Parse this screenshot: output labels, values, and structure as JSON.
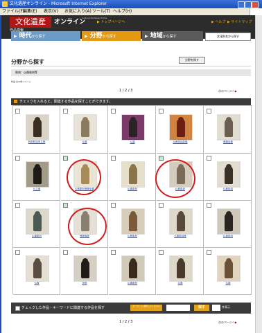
{
  "window": {
    "title": "文化遺産オンライン - Microsoft Internet Explorer"
  },
  "menu": [
    "ファイル(F)",
    "編集(E)",
    "表示(V)",
    "お気に入り(A)",
    "ツール(T)",
    "ヘルプ(H)"
  ],
  "header": {
    "logo_kanji": "文化遺産",
    "logo_online": "オンライン",
    "logo_sub": "Cultural Heritage Online",
    "toppage": "▶ トップページへ",
    "help": "▶ ヘルプ",
    "sitemap": "▶ サイトマップ",
    "search_label": "作品検索"
  },
  "tabs": [
    {
      "label": "時代",
      "small": "から探す"
    },
    {
      "label": "分野",
      "small": "から探す"
    },
    {
      "label": "地域",
      "small": "から探す"
    }
  ],
  "tab_button": "文化財名から探す",
  "page": {
    "title": "分野から探す",
    "change_button": "分野を探す",
    "condition": "彫刻：仏像彫刻等",
    "works_count": "作品 全99件 1ページ",
    "pager": "1 / 2 / 3",
    "next": "次のページへ",
    "next_mark": "▶",
    "instruction": "チェックを入れると、関連する作品を探すことができます。"
  },
  "grid": [
    {
      "caption": "阿弥陀如来立像",
      "checked": false,
      "figure": "#3a2e22",
      "bg": "#d9d4c7"
    },
    {
      "caption": "仏像",
      "checked": false,
      "figure": "#8a7a5e",
      "bg": "#e8e3d6"
    },
    {
      "caption": "仏頭",
      "checked": false,
      "figure": "#2a2228",
      "bg": "#7a3a6a"
    },
    {
      "caption": "仏教説話彫像",
      "checked": false,
      "figure": "#6a1e14",
      "bg": "#d08440"
    },
    {
      "caption": "菩薩坐像",
      "checked": false,
      "figure": "#6a5e50",
      "bg": "#e2ddd1"
    },
    {
      "caption": "仏立像",
      "checked": false,
      "figure": "#1e1a16",
      "bg": "#a49a88"
    },
    {
      "caption": "仏教彫刻菩薩坐像",
      "checked": true,
      "figure": "#a88a56",
      "bg": "#ece4d2"
    },
    {
      "caption": "仏像彫刻",
      "checked": false,
      "figure": "#8a7448",
      "bg": "#e6dfcc"
    },
    {
      "caption": "仏教彫刻",
      "checked": true,
      "figure": "#7a6a58",
      "bg": "#d4ccbc"
    },
    {
      "caption": "仏教彫刻",
      "checked": false,
      "figure": "#3a3026",
      "bg": "#e2ddd0"
    },
    {
      "caption": "仏像彫刻",
      "checked": false,
      "figure": "#4a5a52",
      "bg": "#dcd8cc"
    },
    {
      "caption": "菩薩頭部",
      "checked": true,
      "figure": "#8a7e70",
      "bg": "#e4e0d6"
    },
    {
      "caption": "仏教彫刻",
      "checked": false,
      "figure": "#7a5a3a",
      "bg": "#d8cdb8"
    },
    {
      "caption": "仏像彫刻等",
      "checked": false,
      "figure": "#5a4a3a",
      "bg": "#e0d8c8"
    },
    {
      "caption": "仏像彫刻",
      "checked": false,
      "figure": "#2a2420",
      "bg": "#cfc8ba"
    },
    {
      "caption": "仏像",
      "checked": false,
      "figure": "#5a4e40",
      "bg": "#e4dfd2"
    },
    {
      "caption": "伊勢",
      "checked": false,
      "figure": "#221a14",
      "bg": "#d6d0c2"
    },
    {
      "caption": "仏像彫刻",
      "checked": false,
      "figure": "#3a2a20",
      "bg": "#d2cab8"
    },
    {
      "caption": "仏像",
      "checked": false,
      "figure": "#4a3a2a",
      "bg": "#ded8c8"
    },
    {
      "caption": "仏像",
      "checked": false,
      "figure": "#6a5236",
      "bg": "#e0d4bc"
    }
  ],
  "footer": {
    "checkbox_label": "チェックした作品・キーワードに関連する作品を探す",
    "select": "キーワード 選択してください",
    "search_button": "探す",
    "count_unit": "件表示"
  },
  "accent": {
    "red": "#b01818",
    "orange": "#e39a12",
    "blue": "#6a9bc9",
    "ring": "#d21c1c"
  }
}
